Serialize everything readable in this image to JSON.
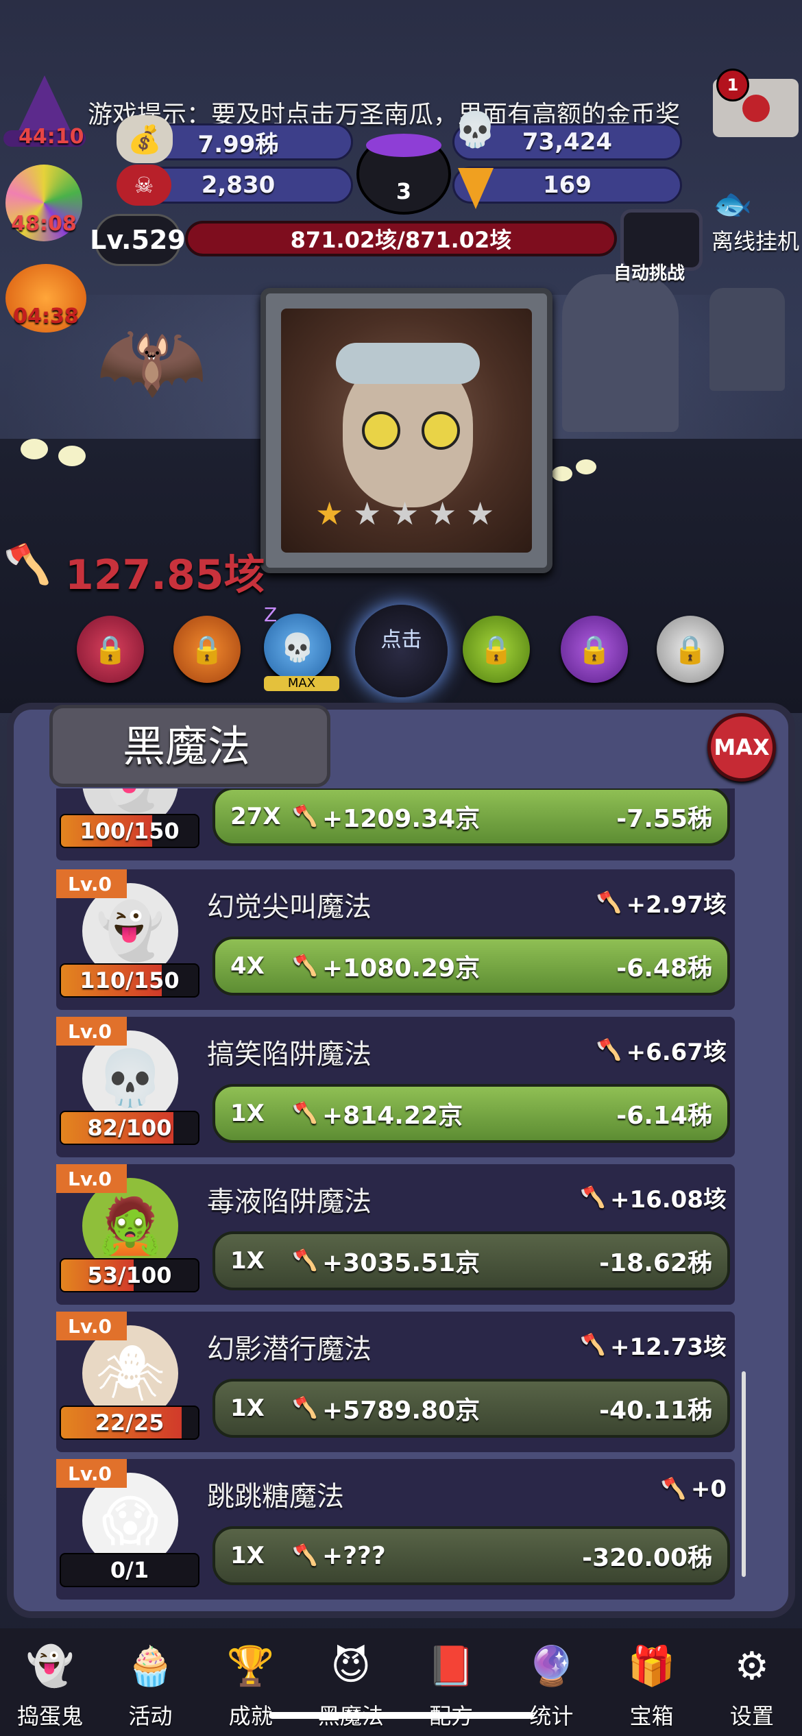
{
  "hud": {
    "tip": "游戏提示：要及时点击万圣南瓜，里面有高额的金币奖",
    "witch_timer": "44:10",
    "candy_timer": "48:08",
    "pumpkin_timer": "04:38",
    "mail_count": "1",
    "stats": {
      "gold": "7.99秭",
      "skulls": "73,424",
      "candy": "2,830",
      "corn": "169",
      "cauldron": "3"
    },
    "level": "Lv.529",
    "hp": "871.02垓/871.02垓",
    "auto_challenge": "自动挑战",
    "offline": "离线挂机",
    "damage": "127.85垓",
    "click_label": "点击",
    "orb_max_label": "MAX",
    "sleep_z": "Z"
  },
  "panel": {
    "title": "黑魔法",
    "max_badge": "MAX",
    "rows": [
      {
        "name": "",
        "lv": "",
        "progress": "100/150",
        "fill": 0.667,
        "mult": "27X",
        "gain": "+1209.34京",
        "cost": "-7.55秭",
        "bonus": "",
        "style": "green",
        "icon": "ghost-icon"
      },
      {
        "name": "幻觉尖叫魔法",
        "lv": "Lv.0",
        "progress": "110/150",
        "fill": 0.733,
        "mult": "4X",
        "gain": "+1080.29京",
        "cost": "-6.48秭",
        "bonus": "+2.97垓",
        "style": "green",
        "icon": "screaming-ghost-icon"
      },
      {
        "name": "搞笑陷阱魔法",
        "lv": "Lv.0",
        "progress": "82/100",
        "fill": 0.82,
        "mult": "1X",
        "gain": "+814.22京",
        "cost": "-6.14秭",
        "bonus": "+6.67垓",
        "style": "green",
        "icon": "skull-icon"
      },
      {
        "name": "毒液陷阱魔法",
        "lv": "Lv.0",
        "progress": "53/100",
        "fill": 0.53,
        "mult": "1X",
        "gain": "+3035.51京",
        "cost": "-18.62秭",
        "bonus": "+16.08垓",
        "style": "dark",
        "icon": "zombie-head-icon"
      },
      {
        "name": "幻影潜行魔法",
        "lv": "Lv.0",
        "progress": "22/25",
        "fill": 0.88,
        "mult": "1X",
        "gain": "+5789.80京",
        "cost": "-40.11秭",
        "bonus": "+12.73垓",
        "style": "dark",
        "icon": "spider-icon"
      },
      {
        "name": "跳跳糖魔法",
        "lv": "Lv.0",
        "progress": "0/1",
        "fill": 0,
        "mult": "1X",
        "gain": "+???",
        "cost": "-320.00秭",
        "bonus": "+0",
        "style": "dark",
        "icon": "scream-mask-icon"
      }
    ]
  },
  "nav": [
    {
      "label": "捣蛋鬼",
      "icon": "ghost-icon"
    },
    {
      "label": "活动",
      "icon": "cupcake-icon"
    },
    {
      "label": "成就",
      "icon": "trophy-icon"
    },
    {
      "label": "黑魔法",
      "icon": "dark-magic-icon"
    },
    {
      "label": "配方",
      "icon": "recipe-book-icon"
    },
    {
      "label": "统计",
      "icon": "crystal-ball-icon"
    },
    {
      "label": "宝箱",
      "icon": "treasure-box-icon"
    },
    {
      "label": "设置",
      "icon": "gear-icon"
    }
  ]
}
